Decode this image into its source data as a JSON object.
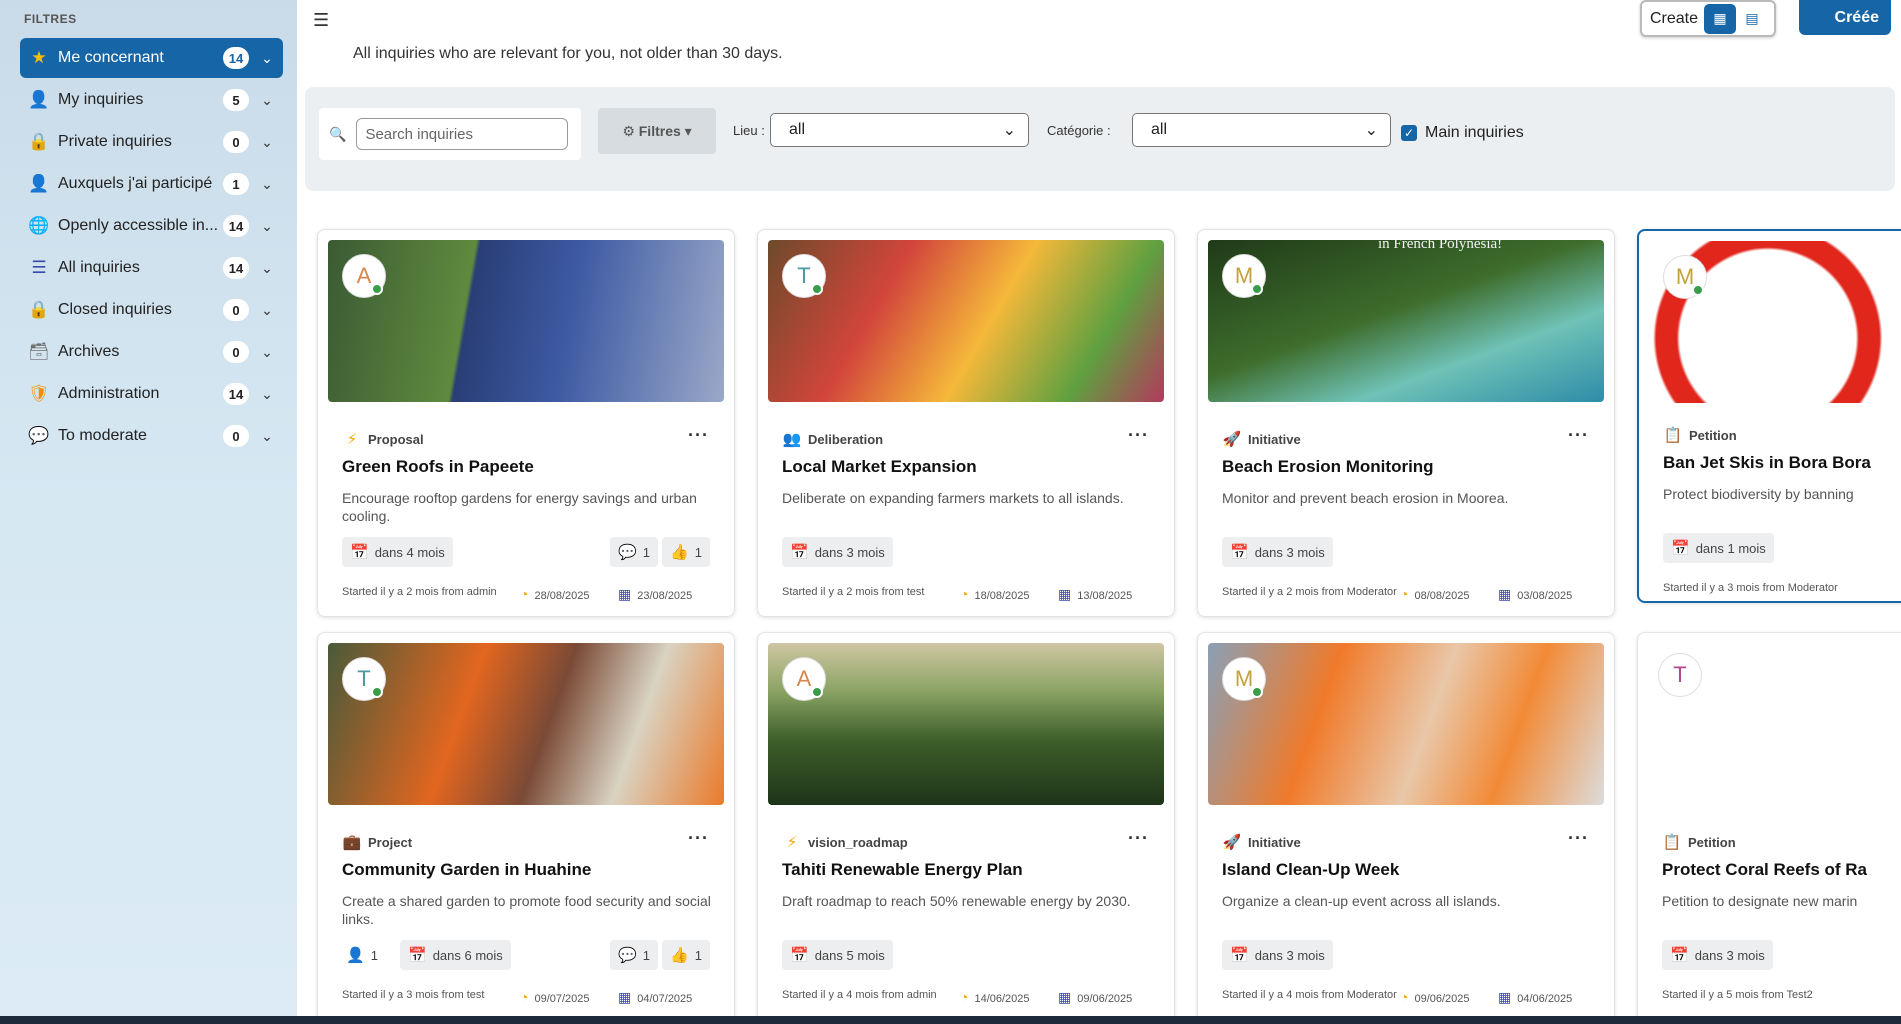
{
  "sidebar": {
    "title": "FILTRES",
    "items": [
      {
        "label": "Me concernant",
        "count": "14",
        "icon": "star-icon",
        "glyph": "★",
        "color": "#f6a800"
      },
      {
        "label": "My inquiries",
        "count": "5",
        "icon": "person-icon",
        "glyph": "👤",
        "color": "#3949ab"
      },
      {
        "label": "Private inquiries",
        "count": "0",
        "icon": "lock-icon",
        "glyph": "🔒",
        "color": "#d32f2f"
      },
      {
        "label": "Auxquels j'ai participé",
        "count": "1",
        "icon": "person-check-icon",
        "glyph": "👤",
        "color": "#00897b"
      },
      {
        "label": "Openly accessible in...",
        "count": "14",
        "icon": "globe-icon",
        "glyph": "🌐",
        "color": "#2e7d32"
      },
      {
        "label": "All inquiries",
        "count": "14",
        "icon": "list-icon",
        "glyph": "☰",
        "color": "#3949ab"
      },
      {
        "label": "Closed inquiries",
        "count": "0",
        "icon": "lock-closed-icon",
        "glyph": "🔒",
        "color": "#5d4037"
      },
      {
        "label": "Archives",
        "count": "0",
        "icon": "archive-icon",
        "glyph": "🗃",
        "color": "#6d6d6d"
      },
      {
        "label": "Administration",
        "count": "14",
        "icon": "shield-icon",
        "glyph": "🛡",
        "color": "#fb8c00"
      },
      {
        "label": "To moderate",
        "count": "0",
        "icon": "comment-icon",
        "glyph": "💬",
        "color": "#1565c0"
      }
    ]
  },
  "header": {
    "subtitle": "All inquiries who are relevant for you, not older than 30 days.",
    "view_label": "Create",
    "create_label": "Créée"
  },
  "filters": {
    "search_placeholder": "Search inquiries",
    "filtres_label": "⚙ Filtres ▾",
    "lieu_label": "Lieu :",
    "lieu_value": "all",
    "categorie_label": "Catégorie :",
    "categorie_value": "all",
    "main_inquiries_label": "Main inquiries",
    "main_inquiries_checked": true
  },
  "cards": [
    {
      "avatar": "A",
      "avatar_color": "#d9874a",
      "type": "Proposal",
      "type_icon": "bolt-icon",
      "type_glyph": "⚡",
      "type_color": "#f6a800",
      "title": "Green Roofs in Papeete",
      "description": "Encourage rooftop gardens for energy savings and urban cooling.",
      "deadline": "dans 4 mois",
      "participants": "",
      "comments": "1",
      "likes": "1",
      "started": "Started il y a 2 mois from admin",
      "date1": "28/08/2025",
      "date2": "23/08/2025",
      "image": "solar-roof-image"
    },
    {
      "avatar": "T",
      "avatar_color": "#4a9aa0",
      "type": "Deliberation",
      "type_icon": "people-icon",
      "type_glyph": "👥",
      "type_color": "#2e7d32",
      "title": "Local Market Expansion",
      "description": "Deliberate on expanding farmers markets to all islands.",
      "deadline": "dans 3 mois",
      "participants": "",
      "comments": "",
      "likes": "",
      "started": "Started il y a 2 mois from test",
      "date1": "18/08/2025",
      "date2": "13/08/2025",
      "image": "flower-market-image"
    },
    {
      "avatar": "M",
      "avatar_color": "#c2a23a",
      "type": "Initiative",
      "type_icon": "rocket-icon",
      "type_glyph": "🚀",
      "type_color": "#e91e63",
      "title": "Beach Erosion Monitoring",
      "description": "Monitor and prevent beach erosion in Moorea.",
      "deadline": "dans 3 mois",
      "participants": "",
      "comments": "",
      "likes": "",
      "started": "Started il y a 2 mois from Moderator",
      "date1": "08/08/2025",
      "date2": "03/08/2025",
      "image": "beach-aerial-image",
      "image_caption": "in French Polynesia!"
    },
    {
      "avatar": "M",
      "avatar_color": "#c2a23a",
      "type": "Petition",
      "type_icon": "clipboard-icon",
      "type_glyph": "📋",
      "type_color": "#00acc1",
      "title": "Ban Jet Skis in Bora Bora",
      "description": "Protect biodiversity by banning",
      "deadline": "dans 1 mois",
      "participants": "",
      "comments": "",
      "likes": "",
      "started": "Started il y a 3 mois from Moderator",
      "date1": "",
      "date2": "",
      "image": "no-jetski-sign-image"
    },
    {
      "avatar": "T",
      "avatar_color": "#4a9aa0",
      "type": "Project",
      "type_icon": "briefcase-icon",
      "type_glyph": "💼",
      "type_color": "#43a047",
      "title": "Community Garden in Huahine",
      "description": "Create a shared garden to promote food security and social links.",
      "deadline": "dans 6 mois",
      "participants": "1",
      "comments": "1",
      "likes": "1",
      "started": "Started il y a 3 mois from test",
      "date1": "09/07/2025",
      "date2": "04/07/2025",
      "image": "volunteers-garden-image"
    },
    {
      "avatar": "A",
      "avatar_color": "#d9874a",
      "type": "vision_roadmap",
      "type_icon": "bolt-icon",
      "type_glyph": "⚡",
      "type_color": "#f6a800",
      "title": "Tahiti Renewable Energy Plan",
      "description": "Draft roadmap to reach 50% renewable energy by 2030.",
      "deadline": "dans 5 mois",
      "participants": "",
      "comments": "",
      "likes": "",
      "started": "Started il y a 4 mois from admin",
      "date1": "14/06/2025",
      "date2": "09/06/2025",
      "image": "green-mountains-image"
    },
    {
      "avatar": "M",
      "avatar_color": "#c2a23a",
      "type": "Initiative",
      "type_icon": "rocket-icon",
      "type_glyph": "🚀",
      "type_color": "#e91e63",
      "title": "Island Clean-Up Week",
      "description": "Organize a clean-up event across all islands.",
      "deadline": "dans 3 mois",
      "participants": "",
      "comments": "",
      "likes": "",
      "started": "Started il y a 4 mois from Moderator",
      "date1": "09/06/2025",
      "date2": "04/06/2025",
      "image": "cleanup-selfie-image"
    },
    {
      "avatar": "T",
      "avatar_color": "#b04a8a",
      "type": "Petition",
      "type_icon": "clipboard-icon",
      "type_glyph": "📋",
      "type_color": "#00acc1",
      "title": "Protect Coral Reefs of Ra",
      "description": "Petition to designate new marin",
      "deadline": "dans 3 mois",
      "participants": "",
      "comments": "",
      "likes": "",
      "started": "Started il y a 5 mois from Test2",
      "date1": "",
      "date2": "",
      "image": ""
    }
  ]
}
